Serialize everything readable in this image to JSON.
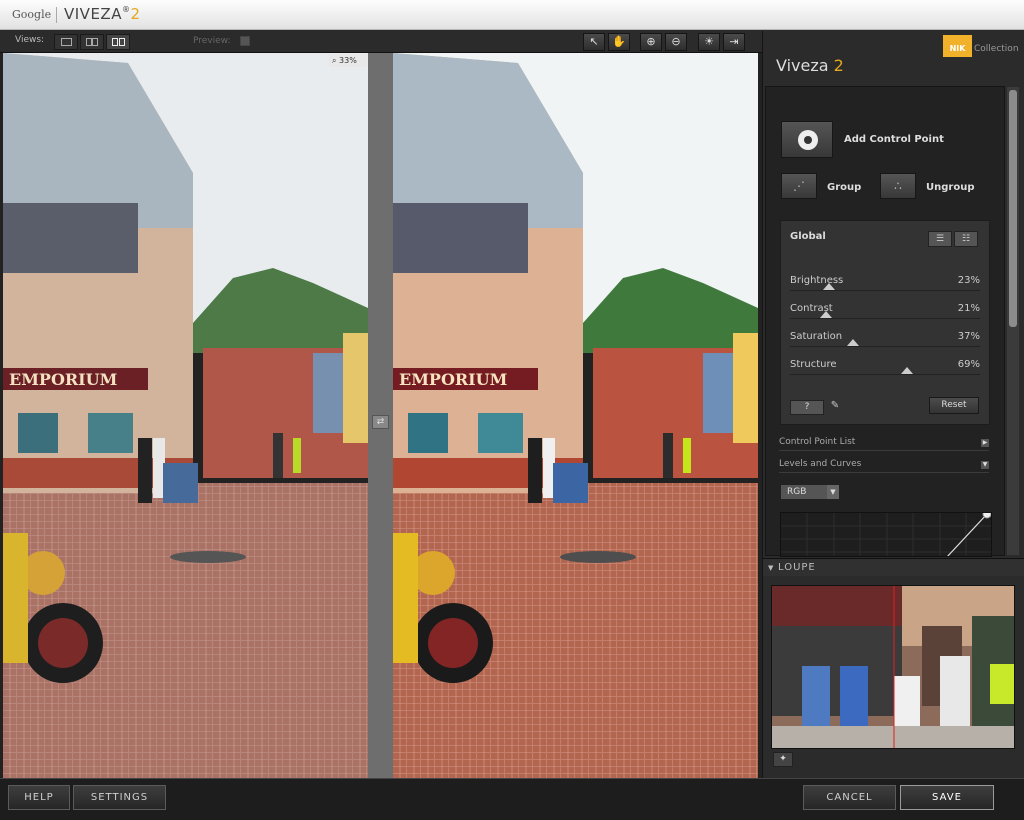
{
  "titlebar": {
    "brand": "Google",
    "product": "VIVEZA",
    "reg": "®",
    "version": "2"
  },
  "toolbar": {
    "views_label": "Views:",
    "preview_label": "Preview:"
  },
  "viewer": {
    "zoom": "33%"
  },
  "panel": {
    "logo_text": "NIK",
    "collection_label": "Collection",
    "title_name": "Viveza",
    "title_version": "2",
    "add_control_point": "Add Control Point",
    "group_label": "Group",
    "ungroup_label": "Ungroup",
    "global": {
      "title": "Global",
      "sliders": [
        {
          "name": "Brightness",
          "value": "23%",
          "level": 0.23
        },
        {
          "name": "Contrast",
          "value": "21%",
          "level": 0.21
        },
        {
          "name": "Saturation",
          "value": "37%",
          "level": 0.37
        },
        {
          "name": "Structure",
          "value": "69%",
          "level": 0.69
        }
      ],
      "help_label": "?",
      "reset_label": "Reset"
    },
    "control_point_list": "Control Point List",
    "levels_curves": "Levels and Curves",
    "channel": "RGB",
    "loupe_label": "LOUPE"
  },
  "footer": {
    "help": "HELP",
    "settings": "SETTINGS",
    "cancel": "CANCEL",
    "save": "SAVE"
  },
  "colors": {
    "accent": "#e3a81d",
    "nik": "#f1b12a"
  }
}
